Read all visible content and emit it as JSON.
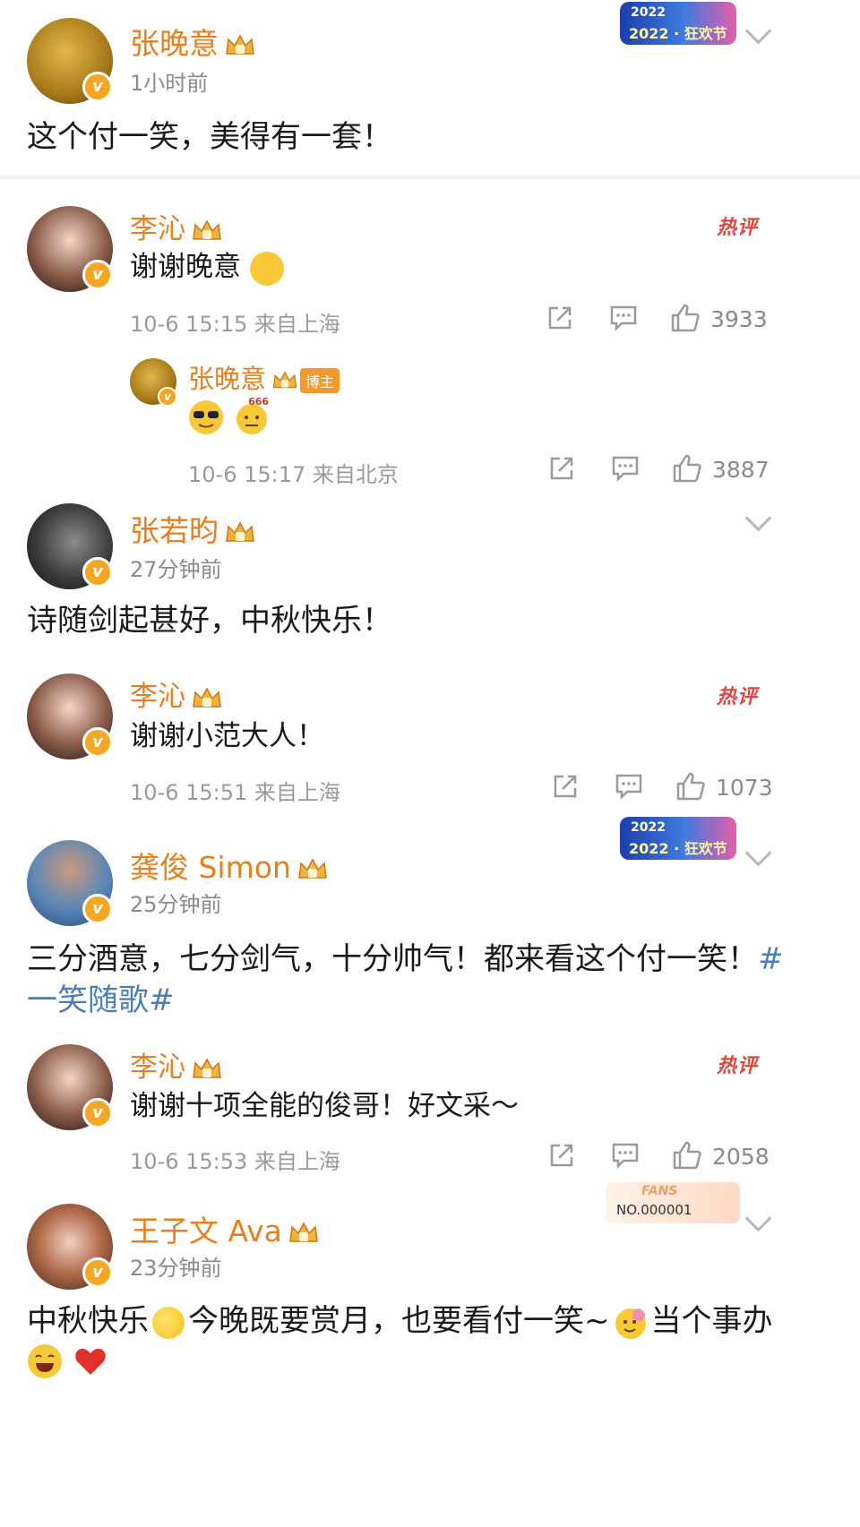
{
  "comments": [
    {
      "user": "张晚意",
      "time": "1小时前",
      "text": "这个付一笑，美得有一套！",
      "banner": "2022 · 狂欢节"
    },
    {
      "user": "李沁",
      "hot": "热评",
      "text": "谢谢晚意",
      "meta": "10-6 15:15 来自上海",
      "likes": "3933"
    },
    {
      "user": "张晚意",
      "tag": "博主",
      "meta": "10-6 15:17 来自北京",
      "likes": "3887",
      "emoji_text": "666"
    },
    {
      "user": "张若昀",
      "time": "27分钟前",
      "text": "诗随剑起甚好，中秋快乐！"
    },
    {
      "user": "李沁",
      "hot": "热评",
      "text": "谢谢小范大人！",
      "meta": "10-6 15:51 来自上海",
      "likes": "1073"
    },
    {
      "user": "龚俊 Simon",
      "time": "25分钟前",
      "text_line1": "三分酒意，七分剑气，十分帅气！都来看这个付一笑！",
      "hashtag_part1": "#",
      "hashtag_part2": "一笑随歌#",
      "banner": "2022 · 狂欢节"
    },
    {
      "user": "李沁",
      "hot": "热评",
      "text": "谢谢十项全能的俊哥！好文采～",
      "meta": "10-6 15:53 来自上海",
      "likes": "2058"
    },
    {
      "user": "王子文 Ava",
      "time": "23分钟前",
      "text_a": "中秋快乐",
      "text_b": "今晚既要赏月，也要看付一笑~",
      "text_c": "当个事办",
      "fans_label": "FANS",
      "fans_no": "NO.000001"
    }
  ],
  "colors": {
    "name": "#e87e1c",
    "link": "#4a7fb5",
    "hot": "#e0463d",
    "meta": "#9a9a9a"
  }
}
